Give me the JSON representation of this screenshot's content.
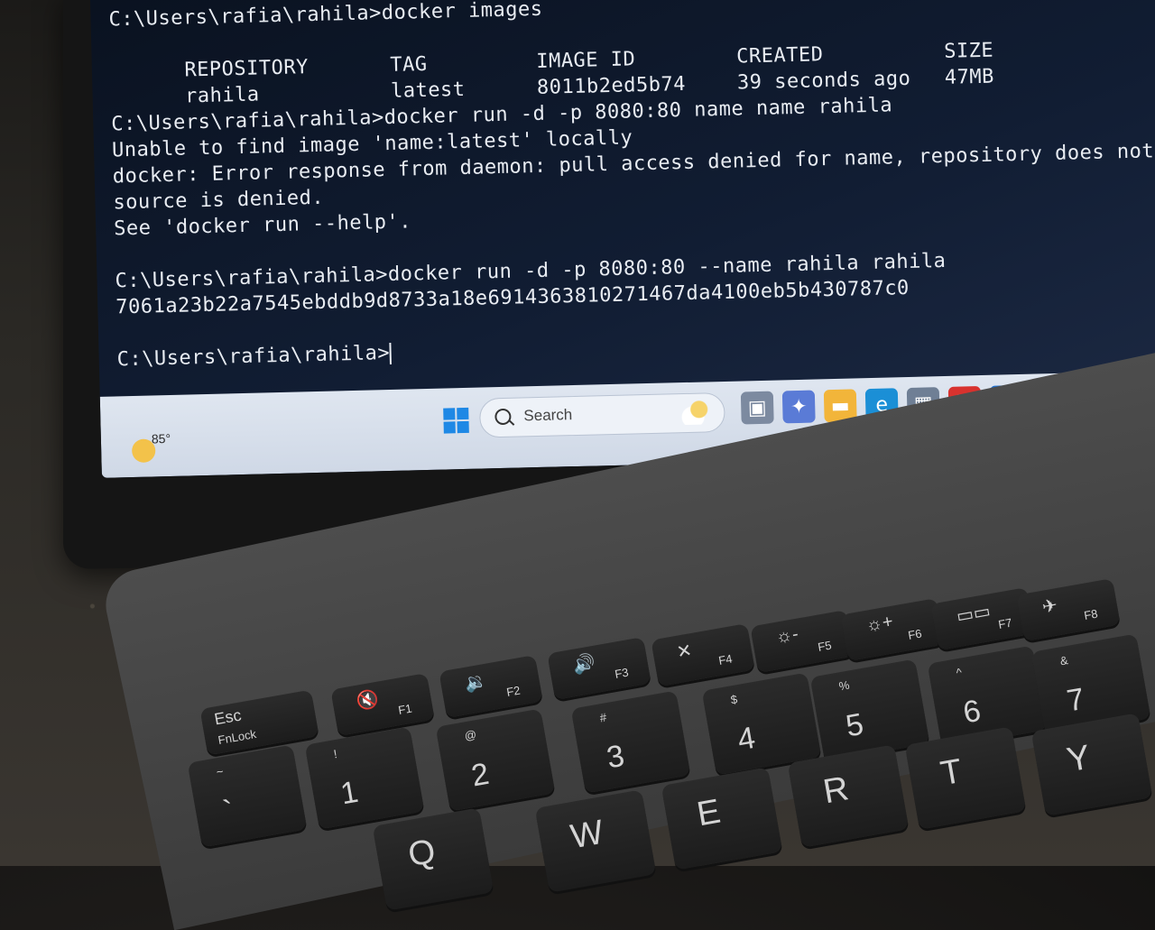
{
  "terminal": {
    "lines": [
      {
        "type": "cmd",
        "text": "C:\\Users\\rafia\\rahila>docker images"
      },
      {
        "type": "table_header",
        "cols": [
          "REPOSITORY",
          "TAG",
          "IMAGE ID",
          "CREATED",
          "SIZE"
        ]
      },
      {
        "type": "table_row",
        "cols": [
          "rahila",
          "latest",
          "8011b2ed5b74",
          "39 seconds ago",
          "47MB"
        ]
      },
      {
        "type": "blank",
        "text": ""
      },
      {
        "type": "cmd",
        "text": "C:\\Users\\rafia\\rahila>docker run -d -p 8080:80 name name rahila"
      },
      {
        "type": "out",
        "text": "Unable to find image 'name:latest' locally"
      },
      {
        "type": "out",
        "text": "docker: Error response from daemon: pull access denied for name, repository does not"
      },
      {
        "type": "out",
        "text": "source is denied."
      },
      {
        "type": "out",
        "text": "See 'docker run --help'."
      },
      {
        "type": "blank",
        "text": ""
      },
      {
        "type": "cmd",
        "text": "C:\\Users\\rafia\\rahila>docker run -d -p 8080:80 --name rahila rahila"
      },
      {
        "type": "out",
        "text": "7061a23b22a7545ebddb9d8733a18e6914363810271467da4100eb5b430787c0"
      },
      {
        "type": "blank",
        "text": ""
      },
      {
        "type": "prompt",
        "text": "C:\\Users\\rafia\\rahila>"
      }
    ]
  },
  "taskbar": {
    "weather_temp": "85°",
    "search_placeholder": "Search",
    "tray_icons": [
      "task-view-icon",
      "copilot-icon",
      "file-explorer-icon",
      "edge-icon",
      "store-icon",
      "mcafee-icon",
      "cortana-icon",
      "notepad-icon",
      "chrome-icon"
    ]
  },
  "keyboard": {
    "function_row": [
      {
        "name": "esc-key",
        "main": "Esc",
        "sub": "FnLock"
      },
      {
        "name": "f1-key",
        "main": "🔇",
        "sub": "F1"
      },
      {
        "name": "f2-key",
        "main": "🔉",
        "sub": "F2"
      },
      {
        "name": "f3-key",
        "main": "🔊",
        "sub": "F3"
      },
      {
        "name": "f4-key",
        "main": "✕",
        "sub": "F4"
      },
      {
        "name": "f5-key",
        "main": "☼-",
        "sub": "F5"
      },
      {
        "name": "f6-key",
        "main": "☼+",
        "sub": "F6"
      },
      {
        "name": "f7-key",
        "main": "▭▭",
        "sub": "F7"
      },
      {
        "name": "f8-key",
        "main": "✈",
        "sub": "F8"
      }
    ],
    "number_row": [
      {
        "name": "tilde-key",
        "main": "`",
        "sub": "~"
      },
      {
        "name": "one-key",
        "main": "1",
        "sub": "!"
      },
      {
        "name": "two-key",
        "main": "2",
        "sub": "@"
      },
      {
        "name": "three-key",
        "main": "3",
        "sub": "#"
      },
      {
        "name": "four-key",
        "main": "4",
        "sub": "$"
      },
      {
        "name": "five-key",
        "main": "5",
        "sub": "%"
      },
      {
        "name": "six-key",
        "main": "6",
        "sub": "^"
      },
      {
        "name": "seven-key",
        "main": "7",
        "sub": "&"
      }
    ],
    "letter_row": [
      "Q",
      "W",
      "E",
      "R",
      "T",
      "Y"
    ]
  }
}
